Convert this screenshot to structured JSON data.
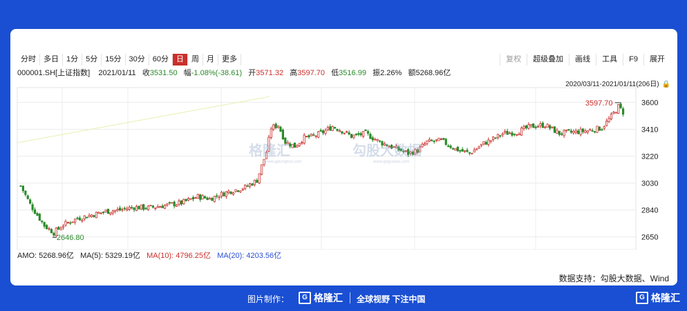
{
  "toolbar": {
    "periods": [
      "分时",
      "多日",
      "1分",
      "5分",
      "15分",
      "30分",
      "60分",
      "日",
      "周",
      "月",
      "更多"
    ],
    "active_index": 7,
    "right": [
      "复权",
      "超级叠加",
      "画线",
      "工具",
      "F9",
      "展开"
    ]
  },
  "info": {
    "symbol": "000001.SH[上证指数]",
    "date": "2021/01/11",
    "close_label": "收",
    "close": "3531.50",
    "change_label": "幅",
    "change": "-1.08%(-38.61)",
    "open_label": "开",
    "open": "3571.32",
    "high_label": "高",
    "high": "3597.70",
    "low_label": "低",
    "low": "3516.99",
    "amp_label": "振",
    "amp": "2.26%",
    "amount_label": "额",
    "amount": "5268.96亿"
  },
  "range": {
    "text": "2020/03/11-2021/01/11(206日)",
    "lock_icon": "lock-icon"
  },
  "indicators": {
    "amo": "AMO: 5268.96亿",
    "ma5": "MA(5): 5329.19亿",
    "ma10": "MA(10): 4796.25亿",
    "ma20": "MA(20): 4203.56亿"
  },
  "watermark": {
    "brand": "格隆汇",
    "brand_site": "www.gelonghui.com",
    "data_brand": "勾股大数据",
    "data_site": "www.gogudata.com"
  },
  "source": "数据支持：勾股大数据、Wind",
  "footer": {
    "made_by": "图片制作：",
    "logo_text": "格隆汇",
    "slogan": "全球视野 下注中国",
    "logo_right": "格隆汇"
  },
  "colors": {
    "up": "#c9302c",
    "down": "#2b8a2b",
    "frame": "#1a4fd3"
  },
  "chart_data": {
    "type": "candlestick",
    "ylim": [
      2560,
      3680
    ],
    "yticks": [
      3600,
      3410,
      3220,
      3030,
      2840,
      2650
    ],
    "high_label": "3597.70",
    "low_label": "2646.80",
    "start": "2020/03/11",
    "end": "2021/01/11",
    "n": 206,
    "anchors": [
      [
        0,
        3010
      ],
      [
        4,
        2880
      ],
      [
        10,
        2730
      ],
      [
        14,
        2680
      ],
      [
        18,
        2735
      ],
      [
        24,
        2780
      ],
      [
        30,
        2805
      ],
      [
        36,
        2830
      ],
      [
        42,
        2840
      ],
      [
        48,
        2860
      ],
      [
        54,
        2855
      ],
      [
        60,
        2870
      ],
      [
        68,
        2890
      ],
      [
        75,
        2935
      ],
      [
        80,
        2920
      ],
      [
        88,
        2970
      ],
      [
        95,
        3000
      ],
      [
        100,
        3050
      ],
      [
        104,
        3250
      ],
      [
        106,
        3420
      ],
      [
        109,
        3440
      ],
      [
        112,
        3320
      ],
      [
        116,
        3290
      ],
      [
        120,
        3350
      ],
      [
        124,
        3360
      ],
      [
        128,
        3390
      ],
      [
        132,
        3430
      ],
      [
        136,
        3400
      ],
      [
        140,
        3360
      ],
      [
        146,
        3380
      ],
      [
        152,
        3320
      ],
      [
        158,
        3280
      ],
      [
        164,
        3240
      ],
      [
        168,
        3260
      ],
      [
        172,
        3320
      ],
      [
        178,
        3330
      ],
      [
        184,
        3270
      ],
      [
        190,
        3240
      ],
      [
        196,
        3310
      ],
      [
        200,
        3340
      ],
      [
        204,
        3380
      ],
      [
        210,
        3390
      ],
      [
        216,
        3430
      ],
      [
        222,
        3440
      ],
      [
        228,
        3380
      ],
      [
        234,
        3390
      ],
      [
        240,
        3400
      ],
      [
        246,
        3420
      ],
      [
        250,
        3500
      ],
      [
        253,
        3570
      ],
      [
        255,
        3531
      ]
    ]
  }
}
